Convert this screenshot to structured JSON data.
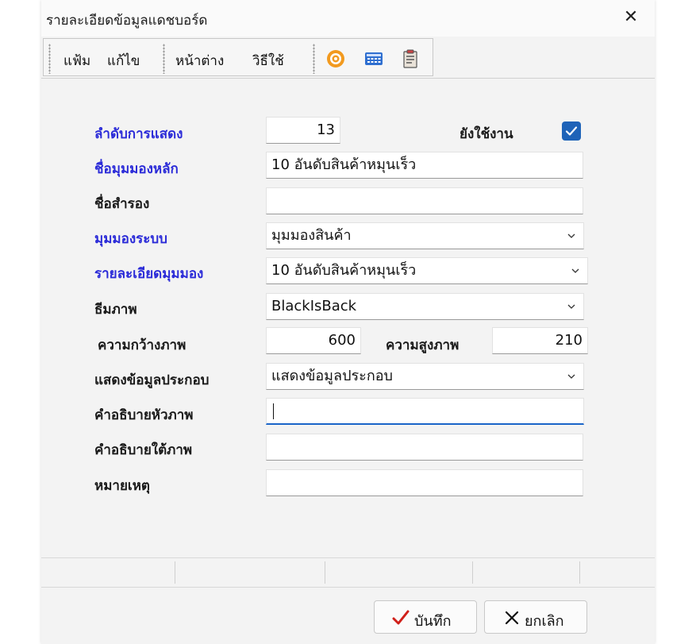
{
  "window": {
    "title": "รายละเอียดข้อมูลแดชบอร์ด",
    "close_glyph": "✕"
  },
  "menu": {
    "file": "แฟ้ม",
    "edit": "แก้ไข",
    "window": "หน้าต่าง",
    "help": "วิธีใช้"
  },
  "toolbar": {
    "icons": [
      "target-icon",
      "calculator-icon",
      "clipboard-icon"
    ]
  },
  "form": {
    "order_label": "ลำดับการแสดง",
    "order_value": "13",
    "active_label": "ยังใช้งาน",
    "active_checked": true,
    "main_view_name_label": "ชื่อมุมมองหลัก",
    "main_view_name_value": "10 อันดับสินค้าหมุนเร็ว",
    "alt_name_label": "ชื่อสำรอง",
    "alt_name_value": "",
    "system_view_label": "มุมมองระบบ",
    "system_view_value": "มุมมองสินค้า",
    "view_detail_label": "รายละเอียดมุมมอง",
    "view_detail_value": "10 อันดับสินค้าหมุนเร็ว",
    "theme_label": "ธีมภาพ",
    "theme_value": "BlackIsBack",
    "width_label": "ความกว้างภาพ",
    "width_value": "600",
    "height_label": "ความสูงภาพ",
    "height_value": "210",
    "extra_label": "แสดงข้อมูลประกอบ",
    "extra_value": "แสดงข้อมูลประกอบ",
    "caption_top_label": "คำอธิบายหัวภาพ",
    "caption_top_value": "",
    "caption_bottom_label": "คำอธิบายใต้ภาพ",
    "caption_bottom_value": "",
    "note_label": "หมายเหตุ",
    "note_value": ""
  },
  "buttons": {
    "save": "บันทึก",
    "cancel": "ยกเลิก"
  },
  "colors": {
    "required_label": "#2b2bd8",
    "accent": "#1e63b8"
  }
}
